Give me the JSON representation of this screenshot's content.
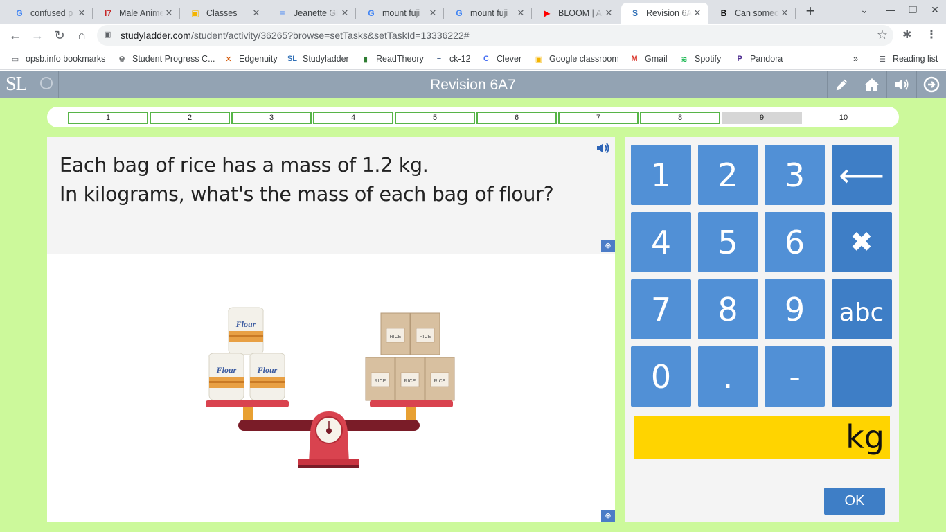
{
  "browser": {
    "tabs": [
      {
        "title": "confused p",
        "icon": "google-icon",
        "color": "#4285f4",
        "glyph": "G"
      },
      {
        "title": "Male Anime",
        "icon": "site-icon",
        "color": "#c62828",
        "glyph": "I7"
      },
      {
        "title": "Classes",
        "icon": "classroom-icon",
        "color": "#f4b400",
        "glyph": "▣"
      },
      {
        "title": "Jeanette Gi",
        "icon": "docs-icon",
        "color": "#4285f4",
        "glyph": "≡"
      },
      {
        "title": "mount fuji",
        "icon": "google-icon",
        "color": "#4285f4",
        "glyph": "G"
      },
      {
        "title": "mount fuji",
        "icon": "google-icon",
        "color": "#4285f4",
        "glyph": "G"
      },
      {
        "title": "BLOOM | An",
        "icon": "youtube-icon",
        "color": "#ff0000",
        "glyph": "▶"
      },
      {
        "title": "Revision 6A",
        "icon": "studyladder-icon",
        "color": "#2f6fb6",
        "glyph": "S"
      },
      {
        "title": "Can someo",
        "icon": "brainly-icon",
        "color": "#111111",
        "glyph": "B"
      }
    ],
    "url_host": "studyladder.com",
    "url_path": "/student/activity/36265?browse=setTasks&setTaskId=13336222#",
    "bookmarks": [
      {
        "label": "opsb.info bookmarks",
        "icon": "folder-icon",
        "glyph": "▭",
        "color": "#5f6368"
      },
      {
        "label": "Student Progress C...",
        "icon": "progress-icon",
        "glyph": "⚙",
        "color": "#3c4043"
      },
      {
        "label": "Edgenuity",
        "icon": "edgenuity-icon",
        "glyph": "✕",
        "color": "#d35400"
      },
      {
        "label": "Studyladder",
        "icon": "studyladder-icon",
        "glyph": "SL",
        "color": "#2f6fb6"
      },
      {
        "label": "ReadTheory",
        "icon": "readtheory-icon",
        "glyph": "▮",
        "color": "#2e7d32"
      },
      {
        "label": "ck-12",
        "icon": "ck12-icon",
        "glyph": "≡",
        "color": "#1a3c6e"
      },
      {
        "label": "Clever",
        "icon": "clever-icon",
        "glyph": "C",
        "color": "#436cf2"
      },
      {
        "label": "Google classroom",
        "icon": "classroom-icon",
        "glyph": "▣",
        "color": "#f4b400"
      },
      {
        "label": "Gmail",
        "icon": "gmail-icon",
        "glyph": "M",
        "color": "#d93025"
      },
      {
        "label": "Spotify",
        "icon": "spotify-icon",
        "glyph": "≋",
        "color": "#1db954"
      },
      {
        "label": "Pandora",
        "icon": "pandora-icon",
        "glyph": "P",
        "color": "#4c2b8f"
      }
    ],
    "reading_list": "Reading list"
  },
  "app": {
    "logo": "SL",
    "title": "Revision 6A7",
    "progress": [
      {
        "label": "1",
        "state": "done"
      },
      {
        "label": "2",
        "state": "done"
      },
      {
        "label": "3",
        "state": "done"
      },
      {
        "label": "4",
        "state": "done"
      },
      {
        "label": "5",
        "state": "done"
      },
      {
        "label": "6",
        "state": "done"
      },
      {
        "label": "7",
        "state": "done"
      },
      {
        "label": "8",
        "state": "done"
      },
      {
        "label": "9",
        "state": "current"
      },
      {
        "label": "10",
        "state": "todo"
      }
    ],
    "question_line1": "Each bag of rice has a mass of 1.2 kg.",
    "question_line2": "In kilograms, what's the mass of each bag of flour?",
    "illustration": {
      "flour_bags": 3,
      "rice_bags": 5,
      "flour_label": "Flour",
      "rice_label": "RICE"
    },
    "keypad": {
      "keys": [
        "1",
        "2",
        "3",
        "⟵",
        "4",
        "5",
        "6",
        "✖",
        "7",
        "8",
        "9",
        "abc",
        "0",
        ".",
        "-",
        ""
      ],
      "answer_value": "",
      "unit": "kg",
      "ok": "OK"
    }
  }
}
